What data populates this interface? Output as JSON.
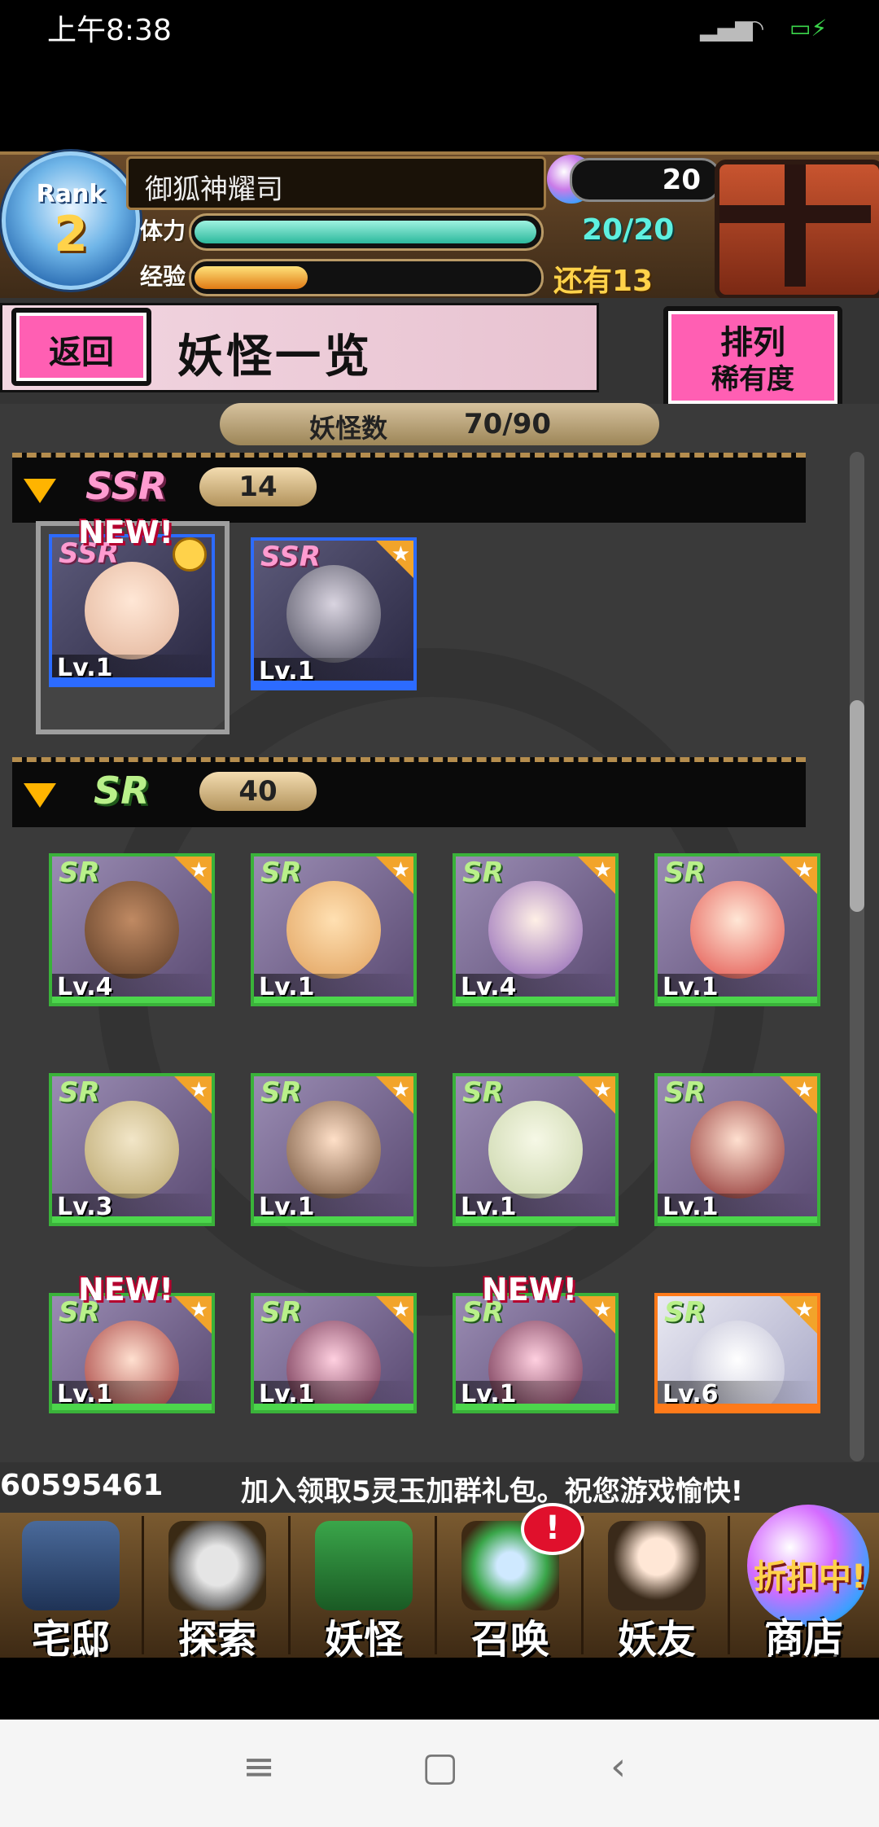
{
  "status_bar": {
    "time": "上午8:38"
  },
  "header": {
    "rank_label": "Rank",
    "rank_value": "2",
    "player_name": "御狐神耀司",
    "gems": "20",
    "stamina_label": "体力",
    "stamina_value": "20/20",
    "stamina_fraction": 1.0,
    "exp_label": "经验",
    "exp_remaining": "还有13",
    "exp_fraction": 0.33
  },
  "title_bar": {
    "back_label": "返回",
    "title": "妖怪一览",
    "sort_line1": "排列",
    "sort_line2": "稀有度"
  },
  "monster_count": {
    "label": "妖怪数",
    "value": "70/90"
  },
  "sections": [
    {
      "rarity": "SSR",
      "count": "14",
      "cards": [
        {
          "level": "Lv.1",
          "new": "NEW!"
        },
        {
          "level": "Lv.1"
        }
      ]
    },
    {
      "rarity": "SR",
      "count": "40",
      "cards": [
        {
          "level": "Lv.4"
        },
        {
          "level": "Lv.1"
        },
        {
          "level": "Lv.4"
        },
        {
          "level": "Lv.1"
        },
        {
          "level": "Lv.3"
        },
        {
          "level": "Lv.1"
        },
        {
          "level": "Lv.1"
        },
        {
          "level": "Lv.1"
        },
        {
          "level": "Lv.1",
          "new": "NEW!"
        },
        {
          "level": "Lv.1"
        },
        {
          "level": "Lv.1",
          "new": "NEW!"
        },
        {
          "level": "Lv.6"
        }
      ]
    }
  ],
  "ticker": {
    "id": "60595461",
    "message": "加入领取5灵玉加群礼包。祝您游戏愉快!"
  },
  "nav": [
    {
      "label": "宅邸"
    },
    {
      "label": "探索"
    },
    {
      "label": "妖怪"
    },
    {
      "label": "召唤",
      "alert": "!"
    },
    {
      "label": "妖友"
    },
    {
      "label": "商店",
      "promo": "折扣中!"
    }
  ],
  "colors": {
    "ssr_border": "#2c6bff",
    "sr_border": "#3ab23a",
    "accent_pink": "#ff5fb3"
  }
}
